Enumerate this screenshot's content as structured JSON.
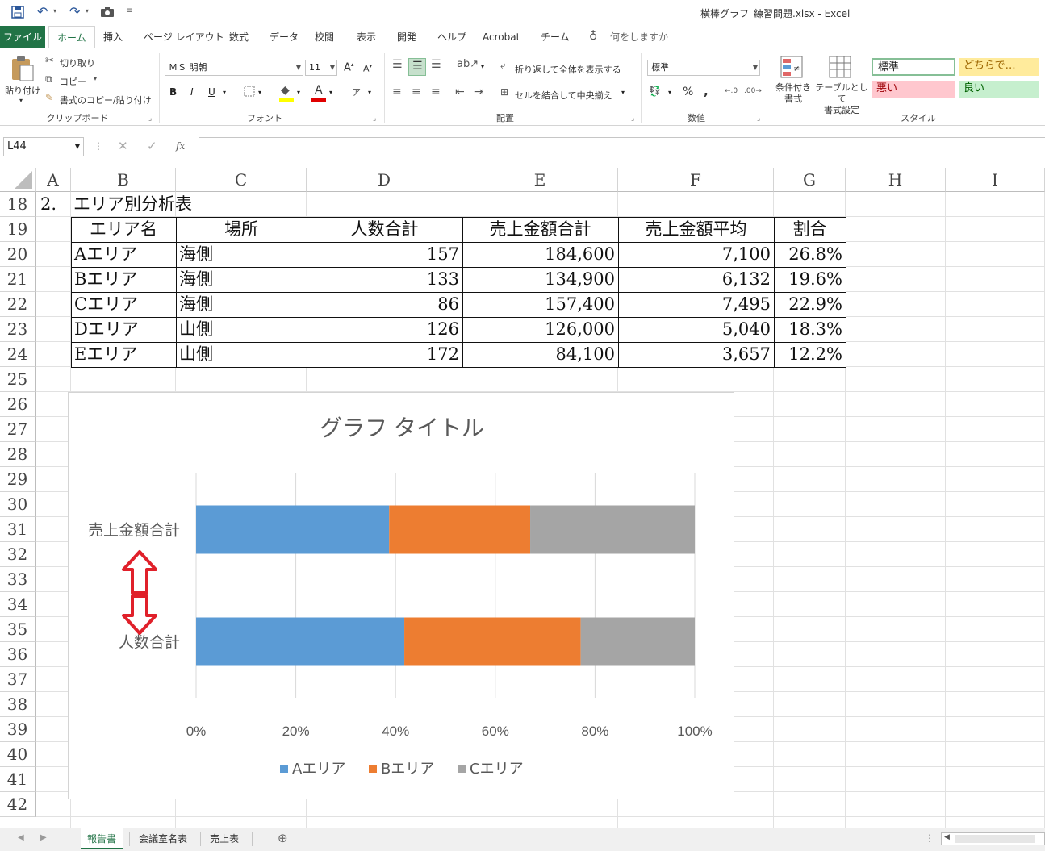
{
  "window": {
    "title": "横棒グラフ_練習問題.xlsx  -  Excel"
  },
  "qat": {
    "save_icon": "save-icon",
    "undo_icon": "undo-icon",
    "redo_icon": "redo-icon",
    "camera_icon": "camera-icon"
  },
  "ribbon_tabs": [
    "ファイル",
    "ホーム",
    "挿入",
    "ページ レイアウト",
    "数式",
    "データ",
    "校閲",
    "表示",
    "開発",
    "ヘルプ",
    "Acrobat",
    "チーム",
    "何をしますか"
  ],
  "ribbon": {
    "clipboard": {
      "paste": "貼り付け",
      "cut": "切り取り",
      "copy": "コピー",
      "format_painter": "書式のコピー/貼り付け",
      "label": "クリップボード"
    },
    "font": {
      "name": "ＭＳ 明朝",
      "size": "11",
      "bold": "B",
      "italic": "I",
      "underline": "U",
      "label": "フォント"
    },
    "alignment": {
      "wrap": "折り返して全体を表示する",
      "merge": "セルを結合して中央揃え",
      "label": "配置"
    },
    "number": {
      "format": "標準",
      "percent": "%",
      "comma": ",",
      "label": "数値"
    },
    "styles": {
      "conditional": "条件付き\n書式",
      "table": "テーブルとして\n書式設定",
      "normal": "標準",
      "neutral": "どちらで…",
      "bad": "悪い",
      "good": "良い",
      "label": "スタイル"
    }
  },
  "formula_bar": {
    "name_box": "L44",
    "fx": "fx",
    "value": ""
  },
  "columns": [
    "A",
    "B",
    "C",
    "D",
    "E",
    "F",
    "G",
    "H",
    "I"
  ],
  "rows": [
    "18",
    "19",
    "20",
    "21",
    "22",
    "23",
    "24",
    "25",
    "26",
    "27",
    "28",
    "29",
    "30",
    "31",
    "32",
    "33",
    "34",
    "35",
    "36",
    "37",
    "38",
    "39",
    "40",
    "41",
    "42"
  ],
  "sheet": {
    "title": "2.　エリア別分析表",
    "headers": [
      "エリア名",
      "場所",
      "人数合計",
      "売上金額合計",
      "売上金額平均",
      "割合"
    ],
    "rows": [
      [
        "Aエリア",
        "海側",
        "157",
        "184,600",
        "7,100",
        "26.8%"
      ],
      [
        "Bエリア",
        "海側",
        "133",
        "134,900",
        "6,132",
        "19.6%"
      ],
      [
        "Cエリア",
        "海側",
        "86",
        "157,400",
        "7,495",
        "22.9%"
      ],
      [
        "Dエリア",
        "山側",
        "126",
        "126,000",
        "5,040",
        "18.3%"
      ],
      [
        "Eエリア",
        "山側",
        "172",
        "84,100",
        "3,657",
        "12.2%"
      ]
    ]
  },
  "chart_data": {
    "type": "bar",
    "orientation": "horizontal",
    "stacked": "percent",
    "title": "グラフ タイトル",
    "categories": [
      "売上金額合計",
      "人数合計"
    ],
    "series": [
      {
        "name": "Aエリア",
        "color": "#5b9bd5",
        "values": [
          184600,
          157
        ]
      },
      {
        "name": "Bエリア",
        "color": "#ed7d31",
        "values": [
          134900,
          133
        ]
      },
      {
        "name": "Cエリア",
        "color": "#a5a5a5",
        "values": [
          157400,
          86
        ]
      }
    ],
    "xticks": [
      "0%",
      "20%",
      "40%",
      "60%",
      "80%",
      "100%"
    ],
    "xlim": [
      0,
      1
    ],
    "grid": true,
    "legend": "bottom"
  },
  "annotation": {
    "arrow_color": "#e0202a"
  },
  "sheet_tabs": [
    "報告書",
    "会議室名表",
    "売上表"
  ],
  "active_sheet": "報告書"
}
